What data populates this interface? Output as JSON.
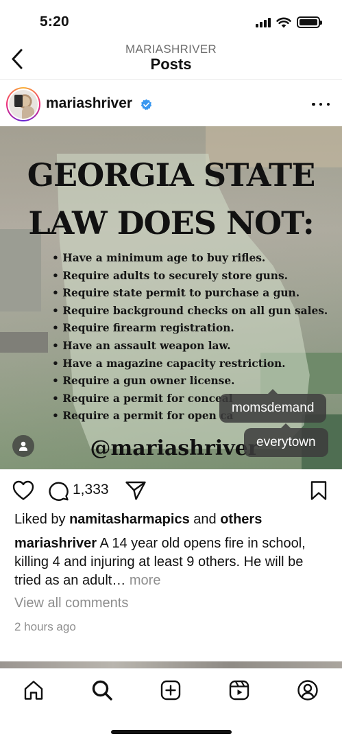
{
  "status_bar": {
    "time": "5:20"
  },
  "header": {
    "account": "MARIASHRIVER",
    "title": "Posts"
  },
  "post": {
    "username": "mariashriver",
    "image": {
      "title_line1": "GEORGIA STATE",
      "title_line2": "LAW DOES NOT:",
      "items": [
        "Have a minimum age to buy rifles.",
        "Require adults to securely store guns.",
        "Require state permit to purchase a gun.",
        "Require background checks on all gun sales.",
        "Require firearm registration.",
        "Have an assault weapon law.",
        "Have a magazine capacity restriction.",
        "Require a gun owner license.",
        "Require a permit for conceal",
        "Require a permit for open ca"
      ],
      "handle": "@mariashriver",
      "tags": [
        "momsdemand",
        "everytown"
      ]
    },
    "comment_count": "1,333",
    "liked_by": {
      "prefix": "Liked by ",
      "user": "namitasharmapics",
      "middle": " and ",
      "others": "others"
    },
    "caption": {
      "username": "mariashriver",
      "text": " A 14 year old opens fire in school, killing 4 and injuring at least 9 others. He will be tried as an adult…",
      "more": " more"
    },
    "view_comments": "View all comments",
    "timestamp": "2 hours ago"
  },
  "icons": {
    "back": "chevron-left-icon",
    "verified": "verified-badge-icon",
    "like": "heart-icon",
    "comment": "comment-bubble-icon",
    "share": "paper-plane-icon",
    "save": "bookmark-icon",
    "tabs": [
      "home-icon",
      "search-icon",
      "create-icon",
      "reels-icon",
      "profile-icon"
    ]
  },
  "colors": {
    "verified": "#3897f0",
    "muted": "#8e8e8e",
    "tag_bg": "#3c3c3c"
  }
}
